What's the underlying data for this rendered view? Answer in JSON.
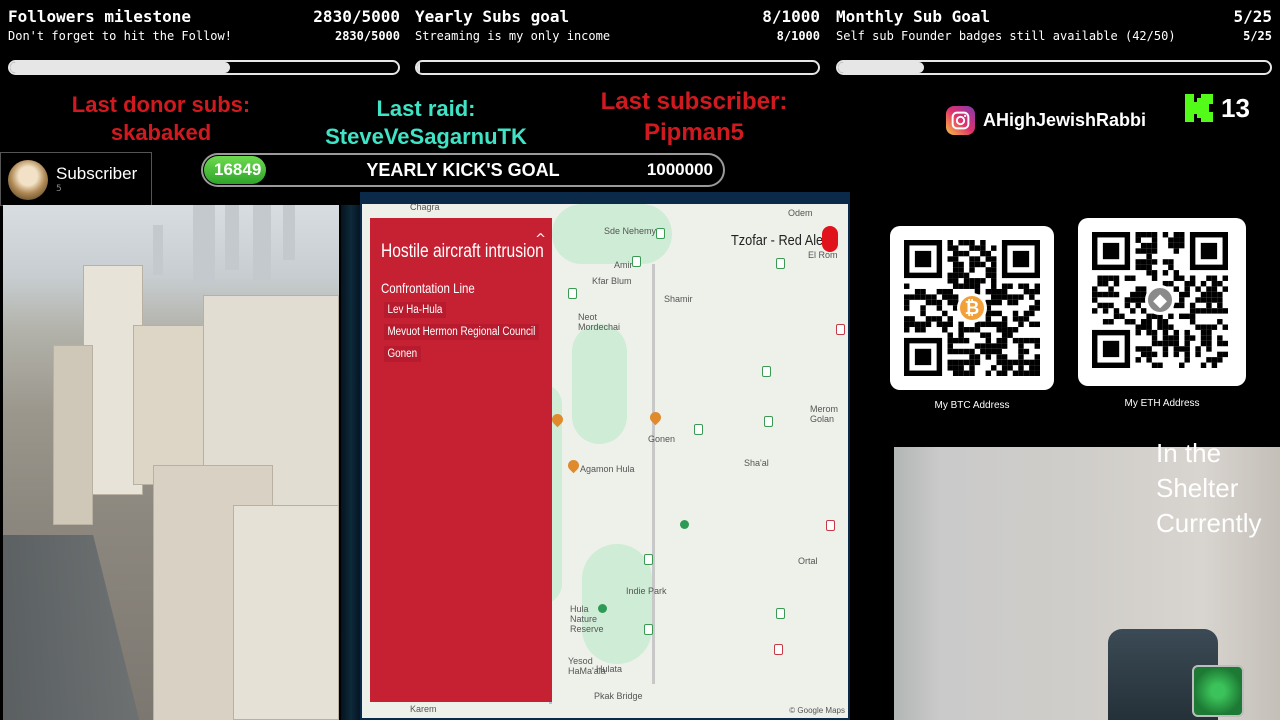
{
  "goals": {
    "followers": {
      "title": "Followers milestone",
      "count": "2830/5000",
      "subtitle": "Don't forget to hit the Follow!",
      "sub_count": "2830/5000",
      "progress": 0.566
    },
    "yearly_subs": {
      "title": "Yearly Subs goal",
      "count": "8/1000",
      "subtitle": "Streaming is my only income",
      "sub_count": "8/1000",
      "progress": 0.008
    },
    "monthly_sub": {
      "title": "Monthly Sub Goal",
      "count": "5/25",
      "subtitle": "Self sub Founder badges still available (42/50)",
      "sub_count": "5/25",
      "progress": 0.2
    }
  },
  "events": {
    "last_donor_label": "Last donor subs:",
    "last_donor_value": "skabaked",
    "last_raid_label": "Last raid:",
    "last_raid_value": "SteveVeSagarnuTK",
    "last_sub_label": "Last subscriber:",
    "last_sub_value": "Pipman5"
  },
  "social": {
    "instagram_handle": "AHighJewishRabbi",
    "kick_count": "13",
    "icons": [
      "instagram-icon",
      "kick-icon"
    ]
  },
  "subscriber_card": {
    "label": "Subscriber",
    "count": "5"
  },
  "kicks_goal": {
    "current": "16849",
    "label": "YEARLY KICK'S GOAL",
    "target": "1000000",
    "progress": 0.0168
  },
  "map": {
    "alert_title": "Hostile aircraft intrusion",
    "section": "Confrontation Line",
    "areas": [
      "Lev Ha-Hula",
      "Mevuot Hermon Regional Council",
      "Gonen"
    ],
    "red_alert_label": "Tzofar - Red Alert",
    "places": [
      "Chagra",
      "Sde Nehemya",
      "Amir",
      "Kfar Blum",
      "Shamir",
      "Neot Mordechai",
      "Gonen",
      "Agamon Hula",
      "Sha'al",
      "Merom Golan",
      "Ortal",
      "Hula Nature Reserve",
      "Hulata",
      "Yesod HaMa'ala",
      "Pkak Bridge",
      "Karem",
      "Odem",
      "El Rom",
      "Indie Park"
    ],
    "attribution": "© Google Maps"
  },
  "crypto": {
    "btc_caption": "My BTC Address",
    "eth_caption": "My ETH Address"
  },
  "webcam": {
    "overlay_text": [
      "In the",
      "Shelter",
      "Currently"
    ]
  },
  "colors": {
    "event_red": "#d11a20",
    "event_cyan": "#3fe3c5",
    "alert_panel": "#c62033",
    "kick_green": "#53fc18"
  }
}
